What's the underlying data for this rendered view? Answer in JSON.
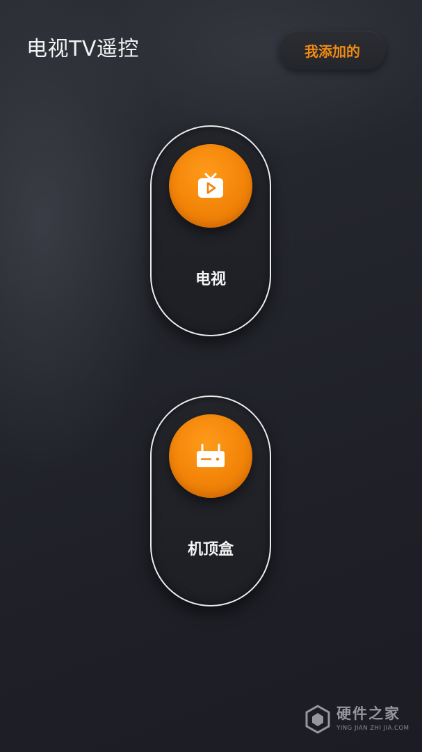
{
  "header": {
    "title": "电视TV遥控",
    "my_added_label": "我添加的"
  },
  "devices": [
    {
      "label": "电视",
      "icon": "tv-icon"
    },
    {
      "label": "机顶盒",
      "icon": "set-top-box-icon"
    }
  ],
  "watermark": {
    "name": "硬件之家",
    "url": "YING JIAN ZHI JIA.COM"
  },
  "colors": {
    "accent": "#f28408",
    "background": "#22242a",
    "card_border": "#ececee",
    "text": "#f2f2f2"
  }
}
